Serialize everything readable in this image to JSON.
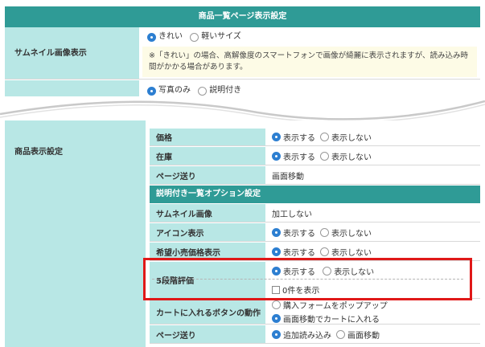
{
  "top": {
    "header": "商品一覧ページ表示設定",
    "thumbnail": {
      "label": "サムネイル画像表示",
      "options": [
        "きれい",
        "軽いサイズ"
      ],
      "selected": 0,
      "note": "※「きれい」の場合、高解像度のスマートフォンで画像が綺麗に表示されますが、読み込み時間がかかる場合があります。"
    },
    "display_type": {
      "options": [
        "写真のみ",
        "説明付き"
      ],
      "selected": 0
    }
  },
  "bottom": {
    "label": "商品表示設定",
    "rows": [
      {
        "label": "価格",
        "options": [
          "表示する",
          "表示しない"
        ],
        "selected": 0
      },
      {
        "label": "在庫",
        "options": [
          "表示する",
          "表示しない"
        ],
        "selected": 0
      },
      {
        "label": "ページ送り",
        "value": "画面移動"
      }
    ],
    "subheader": "説明付き一覧オプション設定",
    "option_rows": [
      {
        "label": "サムネイル画像",
        "value": "加工しない"
      },
      {
        "label": "アイコン表示",
        "options": [
          "表示する",
          "表示しない"
        ],
        "selected": 0
      },
      {
        "label": "希望小売価格表示",
        "options": [
          "表示する",
          "表示しない"
        ],
        "selected": 0
      }
    ],
    "rating": {
      "label": "5段階評価",
      "options": [
        "表示する",
        "表示しない"
      ],
      "selected": 0,
      "checkbox_label": "0件を表示",
      "checked": false
    },
    "cart": {
      "label": "カートに入れるボタンの動作",
      "options": [
        "購入フォームをポップアップ",
        "画面移動でカートに入れる"
      ],
      "selected": 1
    },
    "paging": {
      "label": "ページ送り",
      "options": [
        "追加読み込み",
        "画面移動"
      ],
      "selected": 0
    }
  },
  "colors": {
    "header_teal": "#2f9b96",
    "label_bg": "#b8e7e5",
    "note_bg": "#fdfbe6",
    "radio_selected": "#2d7fd1",
    "highlight": "#e01818"
  }
}
